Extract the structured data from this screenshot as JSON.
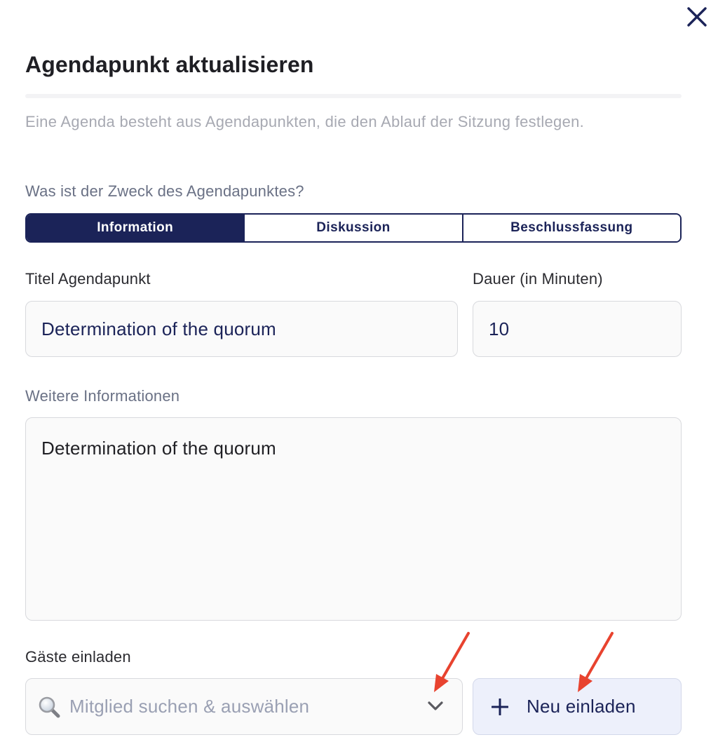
{
  "dialog": {
    "title": "Agendapunkt aktualisieren",
    "subtitle": "Eine Agenda besteht aus Agendapunkten, die den Ablauf der Sitzung festlegen.",
    "close_icon": "close-icon"
  },
  "purpose": {
    "label": "Was ist der Zweck des Agendapunktes?",
    "options": [
      "Information",
      "Diskussion",
      "Beschlussfassung"
    ],
    "selected": "Information"
  },
  "title_field": {
    "label": "Titel Agendapunkt",
    "value": "Determination of the quorum"
  },
  "duration_field": {
    "label": "Dauer (in Minuten)",
    "value": "10"
  },
  "info_field": {
    "label": "Weitere Informationen",
    "value": "Determination of the quorum"
  },
  "guests": {
    "label": "Gäste einladen",
    "search_placeholder": "Mitglied suchen & auswählen",
    "search_icon": "search-icon",
    "dropdown_icon": "chevron-down-icon",
    "invite_button_label": "Neu einladen",
    "invite_icon": "plus-icon"
  },
  "annotations": {
    "arrow_color": "#e8432f"
  },
  "colors": {
    "accent": "#1b2358",
    "muted_text": "#a7a9b2",
    "field_bg": "#fafafa",
    "button_bg": "#edf0fb"
  }
}
